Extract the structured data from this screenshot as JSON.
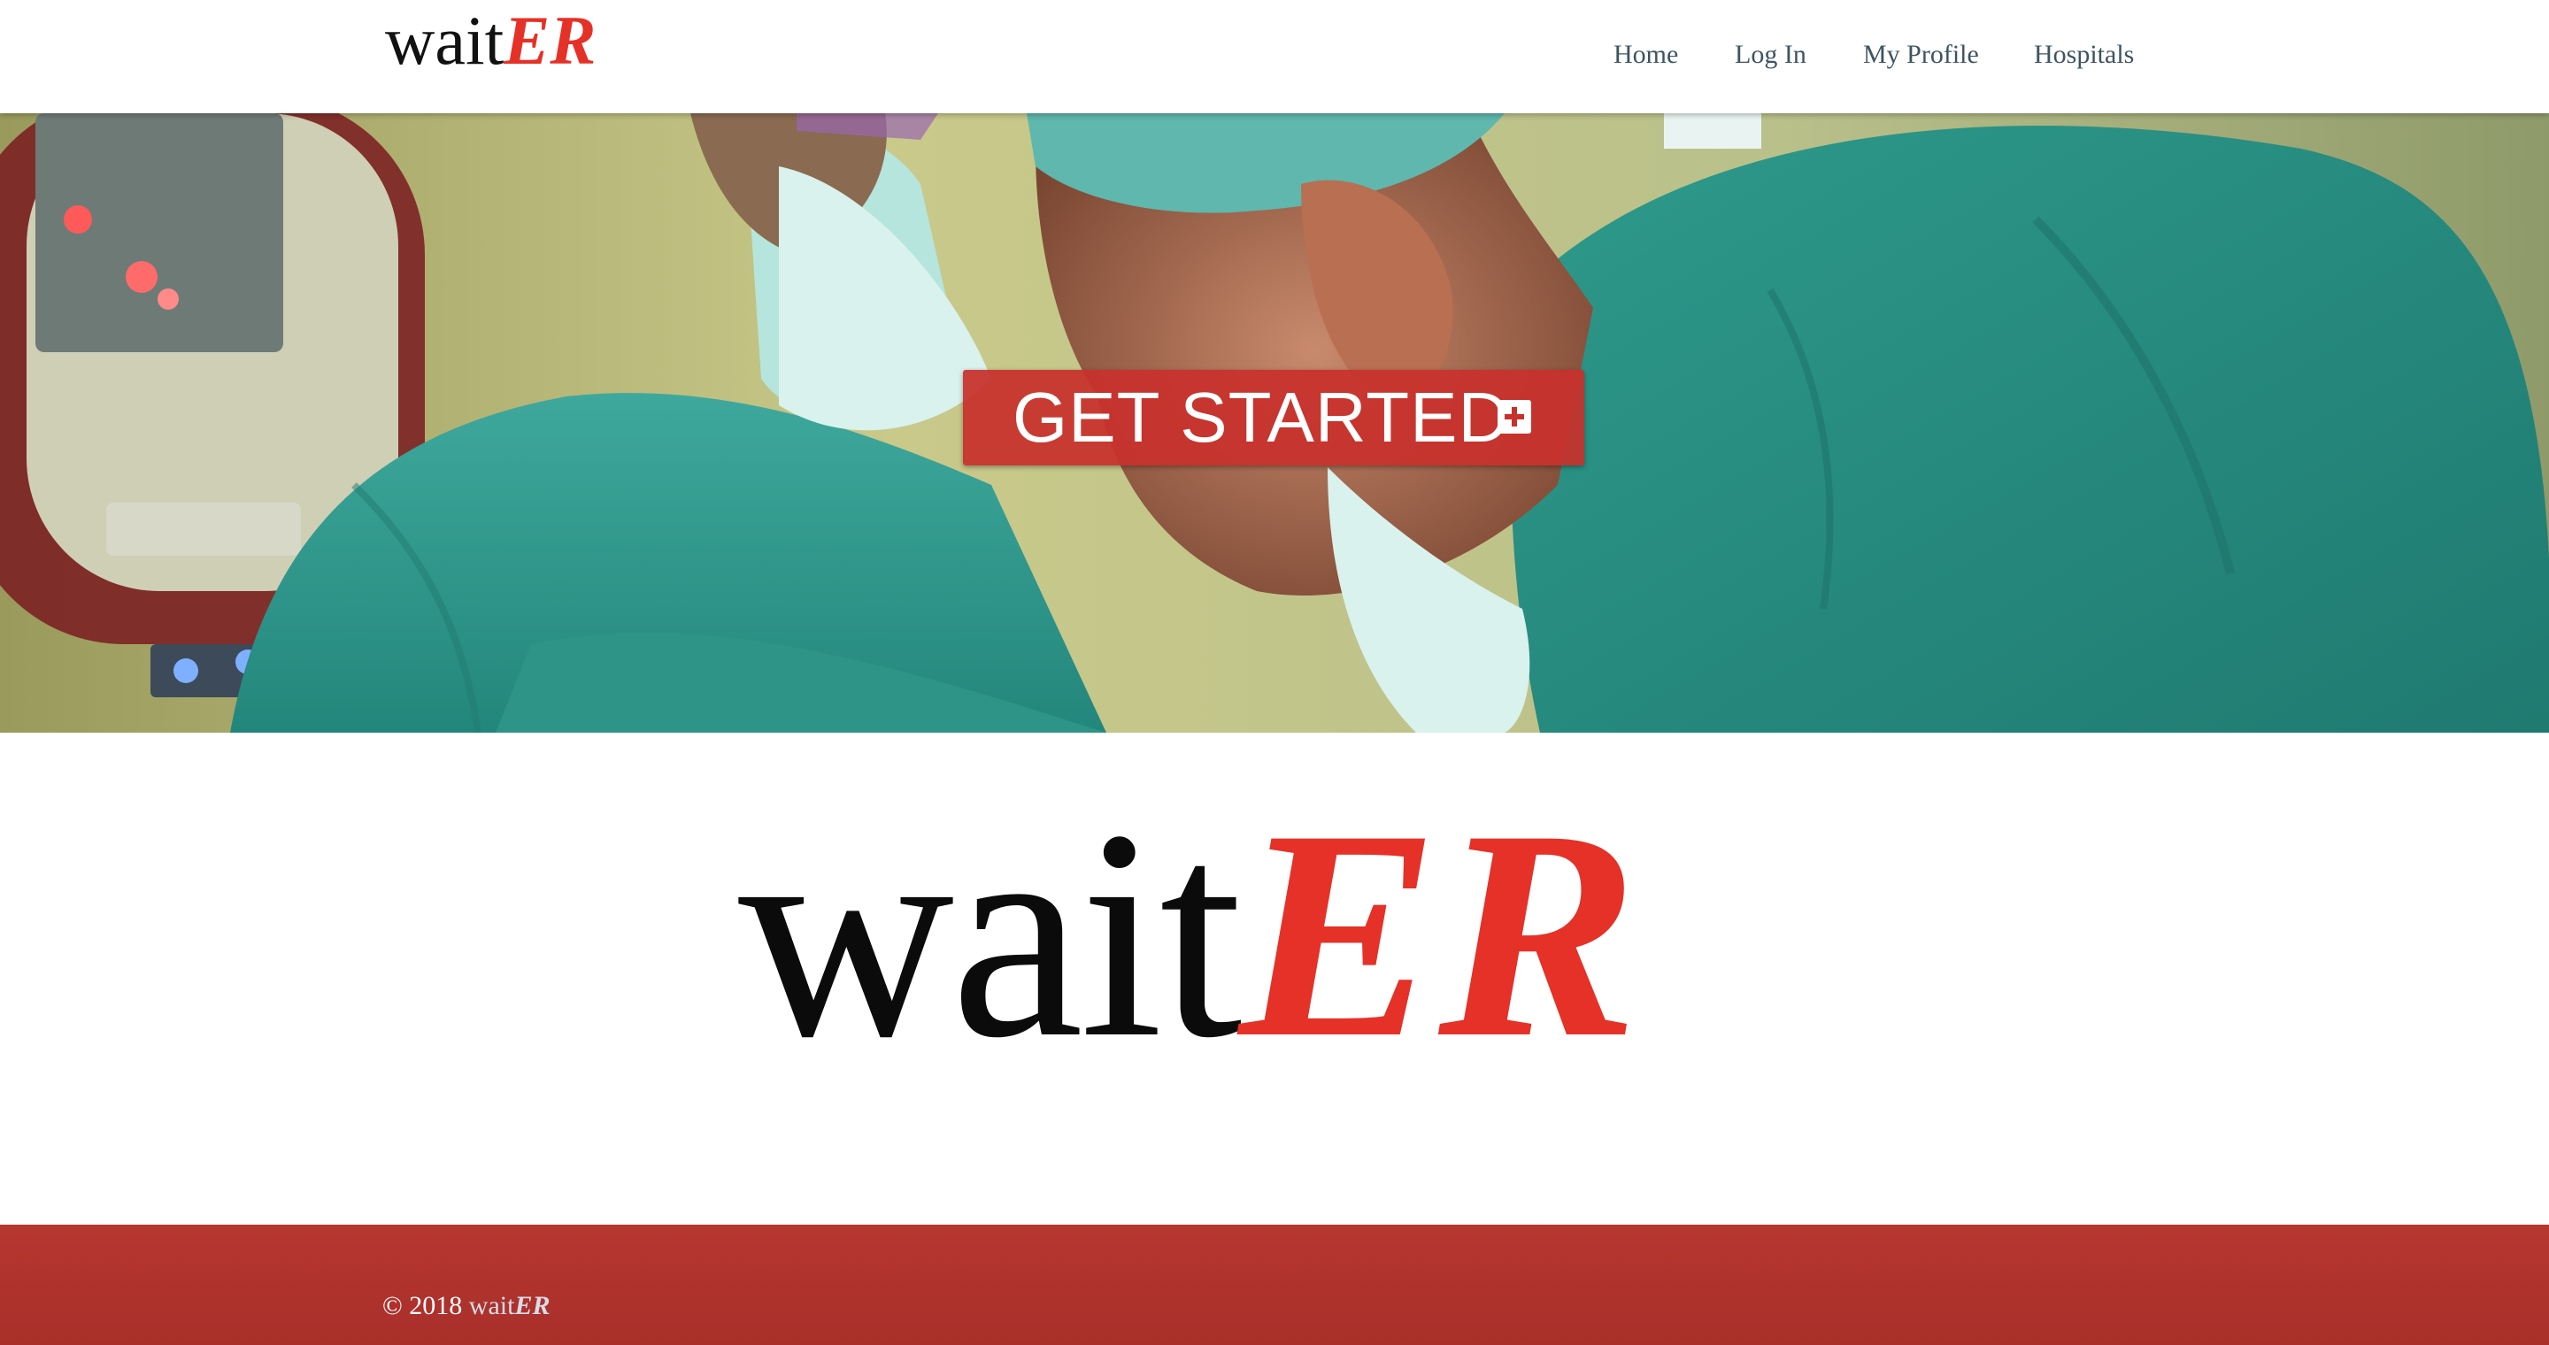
{
  "header": {
    "logo": {
      "wait": "wait",
      "er": "ER"
    },
    "nav": [
      {
        "label": "Home"
      },
      {
        "label": "Log In"
      },
      {
        "label": "My Profile"
      },
      {
        "label": "Hospitals"
      }
    ]
  },
  "hero": {
    "image": "surgeons-operating-photo",
    "cta_label": "GET STARTED",
    "cta_icon": "plus-square-icon"
  },
  "brand": {
    "wait": "wait",
    "er": "ER"
  },
  "footer": {
    "copyright": "© 2018",
    "brand": {
      "wait": "wait",
      "er": "ER"
    }
  },
  "colors": {
    "accent_red": "#e53127",
    "footer_red": "#b73630",
    "nav_text": "#3e5461",
    "scrubs_teal": "#2a8f82"
  }
}
